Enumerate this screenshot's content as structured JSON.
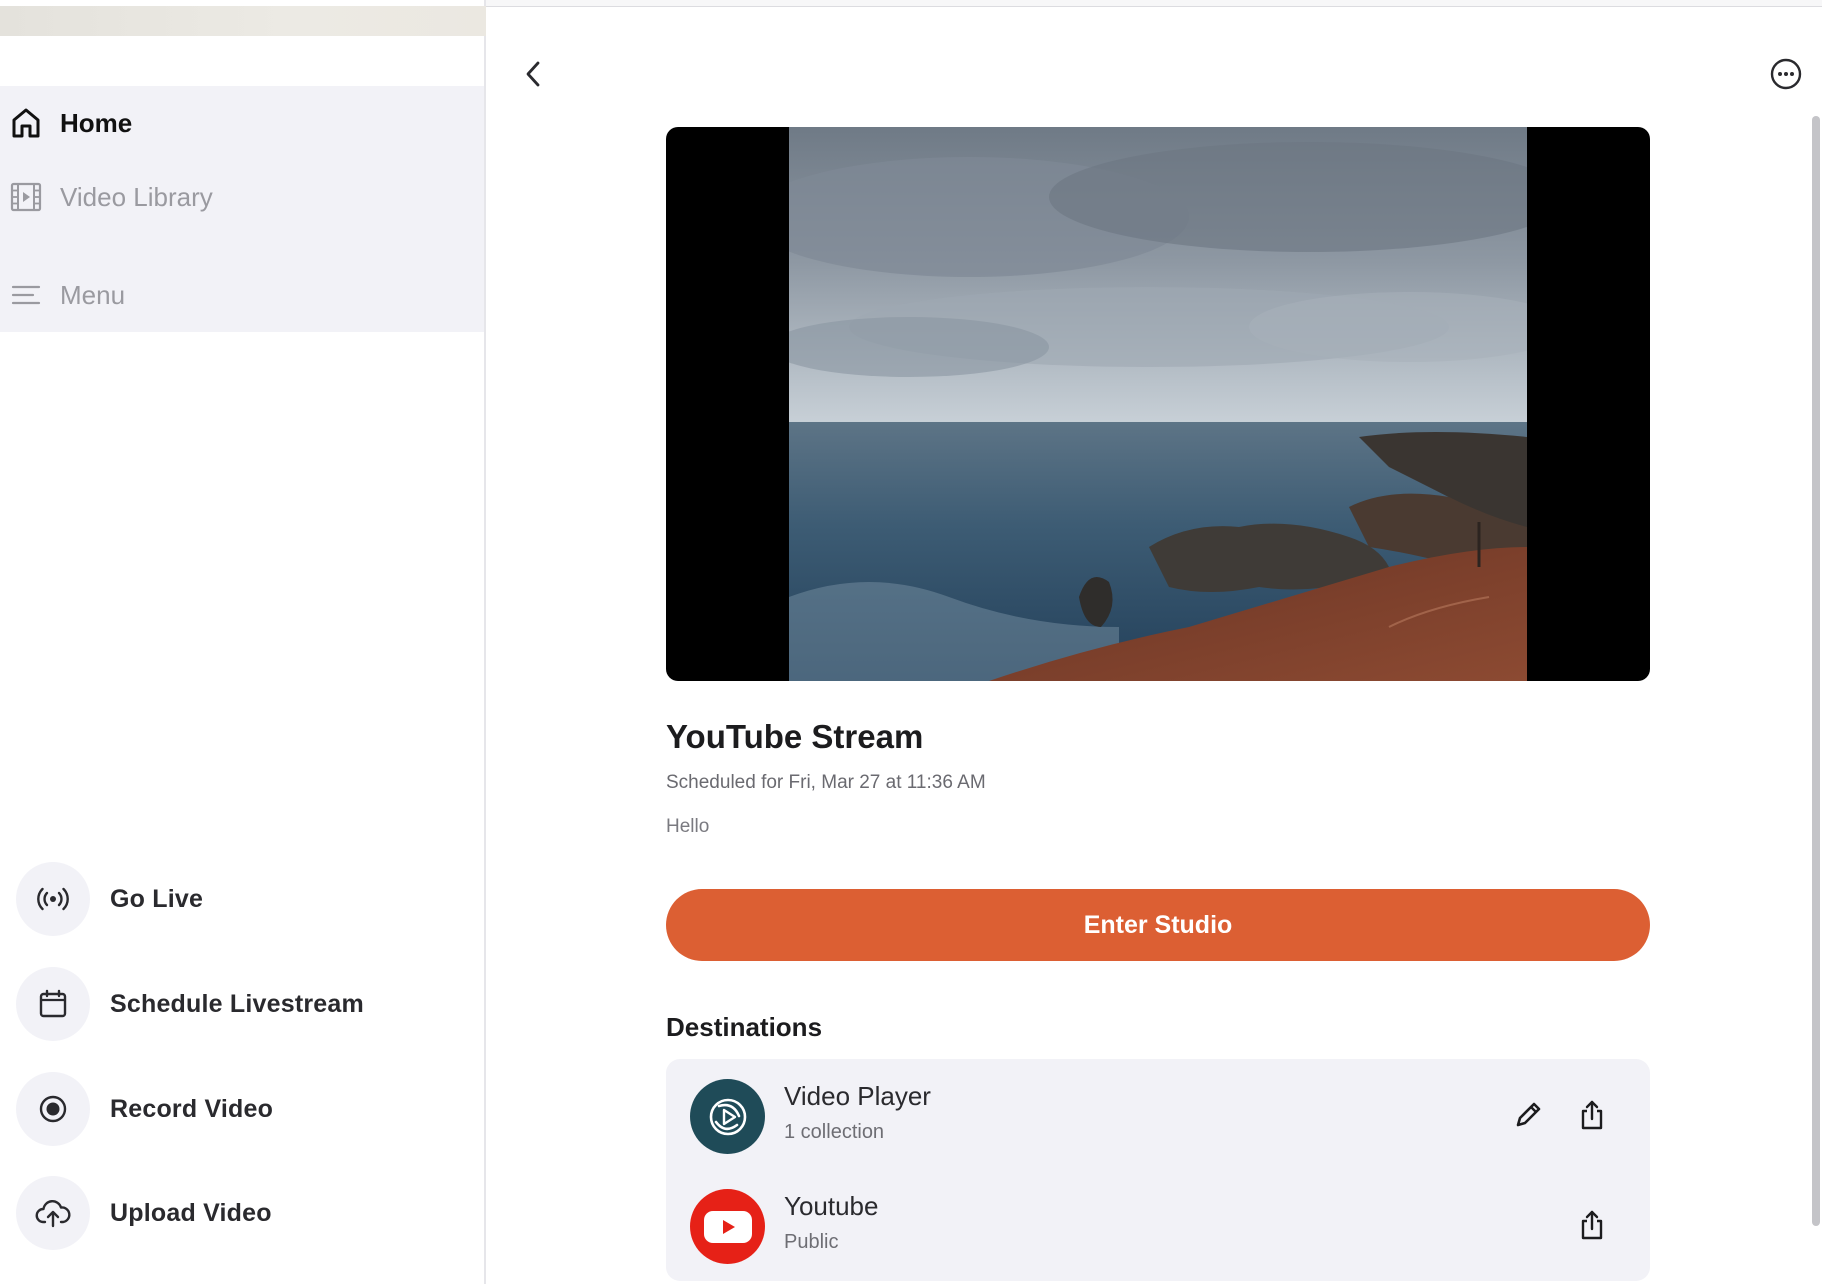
{
  "sidebar": {
    "nav": [
      {
        "label": "Home",
        "icon": "home-icon"
      },
      {
        "label": "Video Library",
        "icon": "film-icon"
      },
      {
        "label": "Menu",
        "icon": "menu-icon"
      }
    ],
    "actions": [
      {
        "label": "Go Live",
        "icon": "broadcast-icon"
      },
      {
        "label": "Schedule Livestream",
        "icon": "calendar-icon"
      },
      {
        "label": "Record Video",
        "icon": "record-icon"
      },
      {
        "label": "Upload Video",
        "icon": "cloud-upload-icon"
      }
    ]
  },
  "main": {
    "back_icon": "chevron-left-icon",
    "more_icon": "more-options-icon",
    "stream": {
      "title": "YouTube Stream",
      "schedule": "Scheduled for Fri, Mar 27 at 11:36 AM",
      "description": "Hello"
    },
    "enter_button": "Enter Studio",
    "destinations": {
      "heading": "Destinations",
      "items": [
        {
          "name": "Video Player",
          "subtitle": "1 collection",
          "icon": "video-player-logo",
          "editable": true
        },
        {
          "name": "Youtube",
          "subtitle": "Public",
          "icon": "youtube-logo",
          "editable": false
        }
      ]
    }
  },
  "colors": {
    "accent": "#dc5f33",
    "sidebar_nav_bg": "#f2f2f7",
    "video_player_logo": "#1f4b58",
    "youtube_red": "#e62117"
  }
}
